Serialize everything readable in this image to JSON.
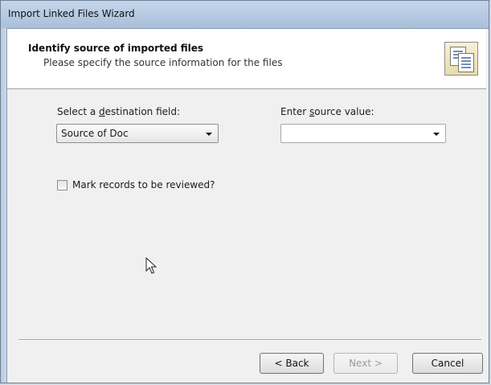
{
  "window": {
    "title": "Import Linked Files Wizard"
  },
  "header": {
    "title": "Identify source of imported files",
    "subtitle": "Please specify the source information for the files",
    "icon": "linked-documents-icon"
  },
  "form": {
    "destination_label_pre": "Select a ",
    "destination_label_key": "d",
    "destination_label_post": "estination field:",
    "destination_value": "Source of Doc",
    "source_label_pre": "Enter ",
    "source_label_key": "s",
    "source_label_post": "ource value:",
    "source_value": "",
    "review_checkbox_label": "Mark records to be reviewed?",
    "review_checked": false
  },
  "buttons": {
    "back": "< Back",
    "next": "Next >",
    "cancel": "Cancel"
  },
  "state": {
    "next_enabled": false
  }
}
